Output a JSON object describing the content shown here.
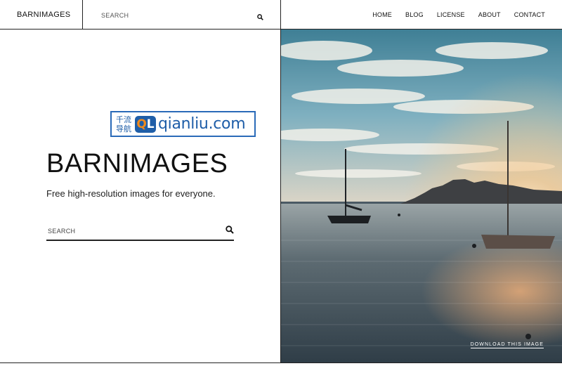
{
  "header": {
    "brand": "BARNIMAGES",
    "search_placeholder": "SEARCH",
    "nav": [
      "HOME",
      "BLOG",
      "LICENSE",
      "ABOUT",
      "CONTACT"
    ]
  },
  "hero": {
    "title": "BARNIMAGES",
    "subtitle": "Free high-resolution images for everyone.",
    "search_placeholder": "SEARCH"
  },
  "watermark": {
    "cn_line1": "千流",
    "cn_line2": "导航",
    "badge_q": "Q",
    "badge_l": "L",
    "text": "qianliu.com"
  },
  "photo": {
    "download_label": "DOWNLOAD THIS IMAGE"
  },
  "colors": {
    "border": "#222222",
    "watermark_blue": "#1f5ea8",
    "watermark_orange": "#f08a1c"
  }
}
